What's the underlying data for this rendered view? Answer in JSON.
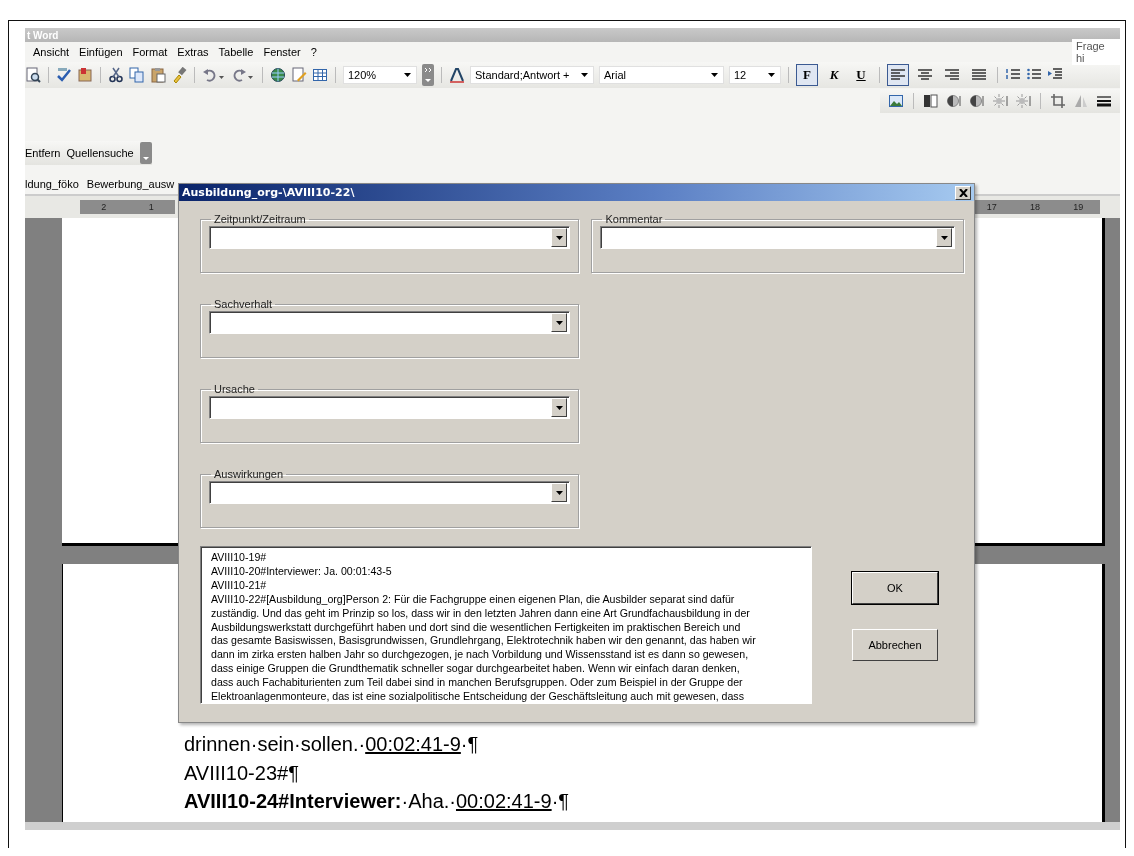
{
  "window": {
    "title": "t Word"
  },
  "menu": {
    "items": [
      "Ansicht",
      "Einfügen",
      "Format",
      "Extras",
      "Tabelle",
      "Fenster",
      "?"
    ],
    "help_box": "Frage hi"
  },
  "formatting_toolbar": {
    "zoom": "120%",
    "style": "Standard;Antwort +",
    "font": "Arial",
    "size": "12",
    "text_buttons": [
      {
        "label": "F",
        "selected": true
      },
      {
        "label": "K",
        "selected": false
      },
      {
        "label": "U",
        "selected": false
      }
    ],
    "alignment": [
      {
        "selected": true
      },
      {
        "selected": false
      },
      {
        "selected": false
      },
      {
        "selected": false
      }
    ]
  },
  "custom_toolbar": {
    "items": [
      "Entfern",
      "Quellensuche"
    ]
  },
  "macro_bar": {
    "items": [
      "ldung_föko",
      "Bewerbung_ausw"
    ]
  },
  "ruler": {
    "left_numbers": [
      "2",
      "1"
    ],
    "right_numbers": [
      "17",
      "18",
      "19"
    ]
  },
  "document": {
    "paragraphs": [
      {
        "text": "drinnen·sein·sollen.·",
        "timestamp": "00:02:41-9",
        "tail": "·¶"
      },
      {
        "text": "AVIII10-23#¶"
      },
      {
        "text": "**AVIII10-24#Interviewer:**·Aha.·",
        "timestamp": "00:02:41-9",
        "tail": "·¶"
      }
    ]
  },
  "dialog": {
    "title": "Ausbildung_org-\\AVIII10-22\\",
    "left_groups": [
      {
        "label": "Zeitpunkt/Zeitraum"
      },
      {
        "label": "Sachverhalt"
      },
      {
        "label": "Ursache"
      },
      {
        "label": "Auswirkungen"
      }
    ],
    "right_groups": [
      {
        "label": "Kommentar"
      }
    ],
    "transcript": [
      "AVIII10-19#",
      "AVIII10-20#Interviewer: Ja. 00:01:43-5",
      "AVIII10-21#",
      "AVIII10-22#[Ausbildung_org]Person 2: Für die Fachgruppe einen eigenen Plan, die Ausbilder separat sind dafür",
      "zuständig. Und das geht im Prinzip so los, dass wir in den letzten Jahren dann eine Art Grundfachausbildung in der",
      "Ausbildungswerkstatt durchgeführt haben und dort sind die wesentlichen Fertigkeiten im praktischen Bereich und",
      "das gesamte Basiswissen, Basisgrundwissen, Grundlehrgang, Elektrotechnik haben wir den genannt, das haben wir",
      "dann im zirka ersten halben Jahr so durchgezogen, je nach Vorbildung und Wissensstand ist es dann so gewesen,",
      "dass einige Gruppen die Grundthematik schneller sogar durchgearbeitet haben. Wenn wir einfach daran denken,",
      "dass auch Fachabiturienten zum Teil dabei sind in manchen Berufsgruppen. Oder zum Beispiel in der Gruppe der",
      "Elektroanlagenmonteure, das ist eine sozialpolitische Entscheidung der Geschäftsleitung auch mit gewesen, dass"
    ],
    "buttons": [
      {
        "label": "OK",
        "default": true
      },
      {
        "label": "Abbrechen",
        "default": false
      }
    ]
  }
}
